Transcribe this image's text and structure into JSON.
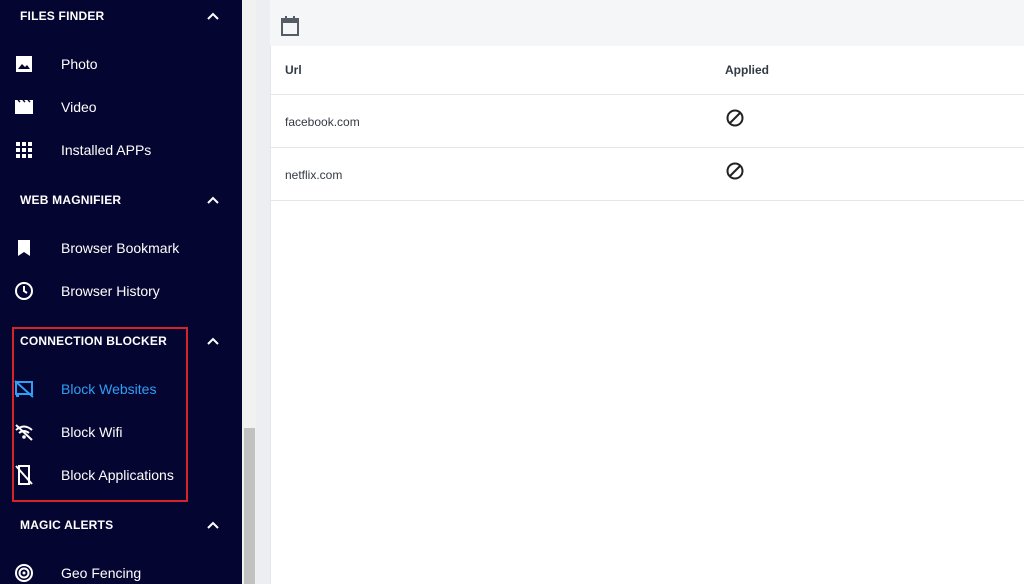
{
  "sidebar": {
    "sections": [
      {
        "title": "FILES FINDER",
        "items": [
          {
            "label": "Photo",
            "icon": "image-icon"
          },
          {
            "label": "Video",
            "icon": "video-clapper-icon"
          },
          {
            "label": "Installed APPs",
            "icon": "apps-grid-icon"
          }
        ]
      },
      {
        "title": "WEB MAGNIFIER",
        "items": [
          {
            "label": "Browser Bookmark",
            "icon": "bookmark-icon"
          },
          {
            "label": "Browser History",
            "icon": "clock-icon"
          }
        ]
      },
      {
        "title": "CONNECTION BLOCKER",
        "items": [
          {
            "label": "Block Websites",
            "icon": "cast-blocked-icon",
            "active": true
          },
          {
            "label": "Block Wifi",
            "icon": "wifi-off-icon"
          },
          {
            "label": "Block Applications",
            "icon": "phone-blocked-icon"
          }
        ]
      },
      {
        "title": "MAGIC ALERTS",
        "items": [
          {
            "label": "Geo Fencing",
            "icon": "geofence-target-icon"
          }
        ]
      }
    ]
  },
  "table": {
    "columns": [
      "Url",
      "Applied"
    ],
    "rows": [
      {
        "url": "facebook.com",
        "applied_icon": "block-icon"
      },
      {
        "url": "netflix.com",
        "applied_icon": "block-icon"
      }
    ]
  },
  "colors": {
    "sidebar_bg": "#050531",
    "active": "#2f9ff5",
    "highlight": "#d8222a"
  }
}
